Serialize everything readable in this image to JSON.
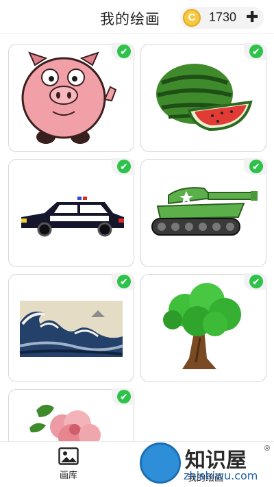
{
  "header": {
    "title": "我的绘画",
    "coin_symbol": "C",
    "coins": "1730",
    "add_symbol": "✚"
  },
  "artworks": [
    {
      "name": "pig",
      "completed": true
    },
    {
      "name": "watermelon",
      "completed": true
    },
    {
      "name": "police-car",
      "completed": true
    },
    {
      "name": "tank",
      "completed": true
    },
    {
      "name": "great-wave",
      "completed": true
    },
    {
      "name": "tree",
      "completed": true
    },
    {
      "name": "flowers",
      "completed": true
    }
  ],
  "check_symbol": "✔",
  "tabbar": {
    "gallery_label": "画库",
    "my_paintings_label": "我的绘画"
  },
  "watermark": {
    "brand": "知识屋",
    "url": "zhishiwu.com",
    "reg": "®"
  },
  "colors": {
    "check_green": "#2fc24a",
    "coin_gold": "#f6c945",
    "watermark_blue": "#2f8ed8"
  }
}
